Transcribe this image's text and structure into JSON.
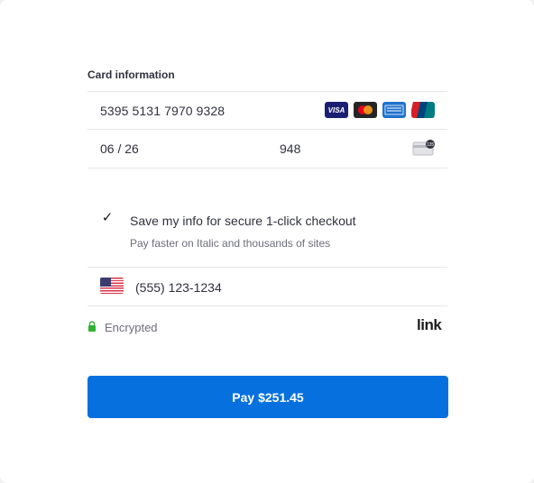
{
  "card_section": {
    "label": "Card information",
    "number": "5395 5131 7970 9328",
    "expiry": "06 / 26",
    "cvc": "948",
    "brands": [
      {
        "name": "visa",
        "text": "VISA"
      },
      {
        "name": "mastercard",
        "text": ""
      },
      {
        "name": "amex",
        "text": "AMERICAN EXPRESS"
      },
      {
        "name": "unionpay",
        "text": "UnionPay"
      }
    ],
    "cvc_icon_text": "135"
  },
  "save_info": {
    "checked": true,
    "check_glyph": "✓",
    "label": "Save my info for secure 1-click checkout",
    "subtext": "Pay faster on Italic and thousands of sites"
  },
  "phone": {
    "country": "US",
    "value": "(555) 123-1234"
  },
  "footer": {
    "encrypted_label": "Encrypted",
    "link_logo": "link"
  },
  "pay_button": {
    "label": "Pay $251.45"
  },
  "colors": {
    "accent": "#0570de",
    "lock": "#30b130"
  }
}
